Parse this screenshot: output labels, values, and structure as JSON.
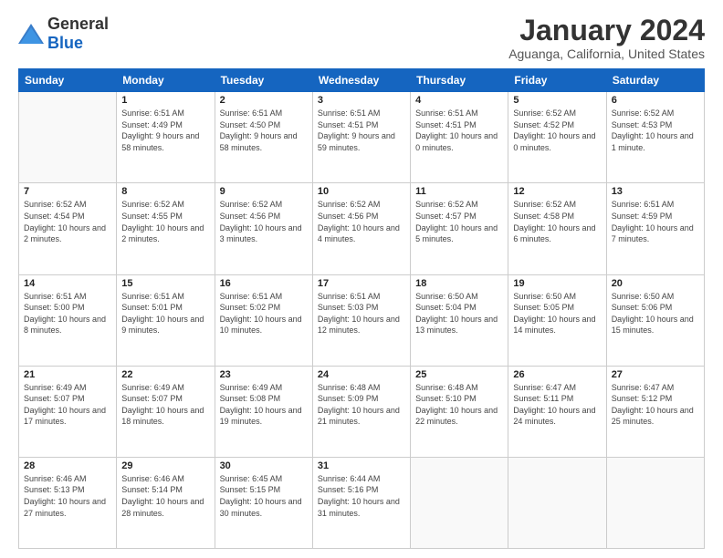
{
  "header": {
    "logo_general": "General",
    "logo_blue": "Blue",
    "month_year": "January 2024",
    "location": "Aguanga, California, United States"
  },
  "weekdays": [
    "Sunday",
    "Monday",
    "Tuesday",
    "Wednesday",
    "Thursday",
    "Friday",
    "Saturday"
  ],
  "weeks": [
    [
      {
        "day": "",
        "sunrise": "",
        "sunset": "",
        "daylight": ""
      },
      {
        "day": "1",
        "sunrise": "Sunrise: 6:51 AM",
        "sunset": "Sunset: 4:49 PM",
        "daylight": "Daylight: 9 hours and 58 minutes."
      },
      {
        "day": "2",
        "sunrise": "Sunrise: 6:51 AM",
        "sunset": "Sunset: 4:50 PM",
        "daylight": "Daylight: 9 hours and 58 minutes."
      },
      {
        "day": "3",
        "sunrise": "Sunrise: 6:51 AM",
        "sunset": "Sunset: 4:51 PM",
        "daylight": "Daylight: 9 hours and 59 minutes."
      },
      {
        "day": "4",
        "sunrise": "Sunrise: 6:51 AM",
        "sunset": "Sunset: 4:51 PM",
        "daylight": "Daylight: 10 hours and 0 minutes."
      },
      {
        "day": "5",
        "sunrise": "Sunrise: 6:52 AM",
        "sunset": "Sunset: 4:52 PM",
        "daylight": "Daylight: 10 hours and 0 minutes."
      },
      {
        "day": "6",
        "sunrise": "Sunrise: 6:52 AM",
        "sunset": "Sunset: 4:53 PM",
        "daylight": "Daylight: 10 hours and 1 minute."
      }
    ],
    [
      {
        "day": "7",
        "sunrise": "Sunrise: 6:52 AM",
        "sunset": "Sunset: 4:54 PM",
        "daylight": "Daylight: 10 hours and 2 minutes."
      },
      {
        "day": "8",
        "sunrise": "Sunrise: 6:52 AM",
        "sunset": "Sunset: 4:55 PM",
        "daylight": "Daylight: 10 hours and 2 minutes."
      },
      {
        "day": "9",
        "sunrise": "Sunrise: 6:52 AM",
        "sunset": "Sunset: 4:56 PM",
        "daylight": "Daylight: 10 hours and 3 minutes."
      },
      {
        "day": "10",
        "sunrise": "Sunrise: 6:52 AM",
        "sunset": "Sunset: 4:56 PM",
        "daylight": "Daylight: 10 hours and 4 minutes."
      },
      {
        "day": "11",
        "sunrise": "Sunrise: 6:52 AM",
        "sunset": "Sunset: 4:57 PM",
        "daylight": "Daylight: 10 hours and 5 minutes."
      },
      {
        "day": "12",
        "sunrise": "Sunrise: 6:52 AM",
        "sunset": "Sunset: 4:58 PM",
        "daylight": "Daylight: 10 hours and 6 minutes."
      },
      {
        "day": "13",
        "sunrise": "Sunrise: 6:51 AM",
        "sunset": "Sunset: 4:59 PM",
        "daylight": "Daylight: 10 hours and 7 minutes."
      }
    ],
    [
      {
        "day": "14",
        "sunrise": "Sunrise: 6:51 AM",
        "sunset": "Sunset: 5:00 PM",
        "daylight": "Daylight: 10 hours and 8 minutes."
      },
      {
        "day": "15",
        "sunrise": "Sunrise: 6:51 AM",
        "sunset": "Sunset: 5:01 PM",
        "daylight": "Daylight: 10 hours and 9 minutes."
      },
      {
        "day": "16",
        "sunrise": "Sunrise: 6:51 AM",
        "sunset": "Sunset: 5:02 PM",
        "daylight": "Daylight: 10 hours and 10 minutes."
      },
      {
        "day": "17",
        "sunrise": "Sunrise: 6:51 AM",
        "sunset": "Sunset: 5:03 PM",
        "daylight": "Daylight: 10 hours and 12 minutes."
      },
      {
        "day": "18",
        "sunrise": "Sunrise: 6:50 AM",
        "sunset": "Sunset: 5:04 PM",
        "daylight": "Daylight: 10 hours and 13 minutes."
      },
      {
        "day": "19",
        "sunrise": "Sunrise: 6:50 AM",
        "sunset": "Sunset: 5:05 PM",
        "daylight": "Daylight: 10 hours and 14 minutes."
      },
      {
        "day": "20",
        "sunrise": "Sunrise: 6:50 AM",
        "sunset": "Sunset: 5:06 PM",
        "daylight": "Daylight: 10 hours and 15 minutes."
      }
    ],
    [
      {
        "day": "21",
        "sunrise": "Sunrise: 6:49 AM",
        "sunset": "Sunset: 5:07 PM",
        "daylight": "Daylight: 10 hours and 17 minutes."
      },
      {
        "day": "22",
        "sunrise": "Sunrise: 6:49 AM",
        "sunset": "Sunset: 5:07 PM",
        "daylight": "Daylight: 10 hours and 18 minutes."
      },
      {
        "day": "23",
        "sunrise": "Sunrise: 6:49 AM",
        "sunset": "Sunset: 5:08 PM",
        "daylight": "Daylight: 10 hours and 19 minutes."
      },
      {
        "day": "24",
        "sunrise": "Sunrise: 6:48 AM",
        "sunset": "Sunset: 5:09 PM",
        "daylight": "Daylight: 10 hours and 21 minutes."
      },
      {
        "day": "25",
        "sunrise": "Sunrise: 6:48 AM",
        "sunset": "Sunset: 5:10 PM",
        "daylight": "Daylight: 10 hours and 22 minutes."
      },
      {
        "day": "26",
        "sunrise": "Sunrise: 6:47 AM",
        "sunset": "Sunset: 5:11 PM",
        "daylight": "Daylight: 10 hours and 24 minutes."
      },
      {
        "day": "27",
        "sunrise": "Sunrise: 6:47 AM",
        "sunset": "Sunset: 5:12 PM",
        "daylight": "Daylight: 10 hours and 25 minutes."
      }
    ],
    [
      {
        "day": "28",
        "sunrise": "Sunrise: 6:46 AM",
        "sunset": "Sunset: 5:13 PM",
        "daylight": "Daylight: 10 hours and 27 minutes."
      },
      {
        "day": "29",
        "sunrise": "Sunrise: 6:46 AM",
        "sunset": "Sunset: 5:14 PM",
        "daylight": "Daylight: 10 hours and 28 minutes."
      },
      {
        "day": "30",
        "sunrise": "Sunrise: 6:45 AM",
        "sunset": "Sunset: 5:15 PM",
        "daylight": "Daylight: 10 hours and 30 minutes."
      },
      {
        "day": "31",
        "sunrise": "Sunrise: 6:44 AM",
        "sunset": "Sunset: 5:16 PM",
        "daylight": "Daylight: 10 hours and 31 minutes."
      },
      {
        "day": "",
        "sunrise": "",
        "sunset": "",
        "daylight": ""
      },
      {
        "day": "",
        "sunrise": "",
        "sunset": "",
        "daylight": ""
      },
      {
        "day": "",
        "sunrise": "",
        "sunset": "",
        "daylight": ""
      }
    ]
  ]
}
